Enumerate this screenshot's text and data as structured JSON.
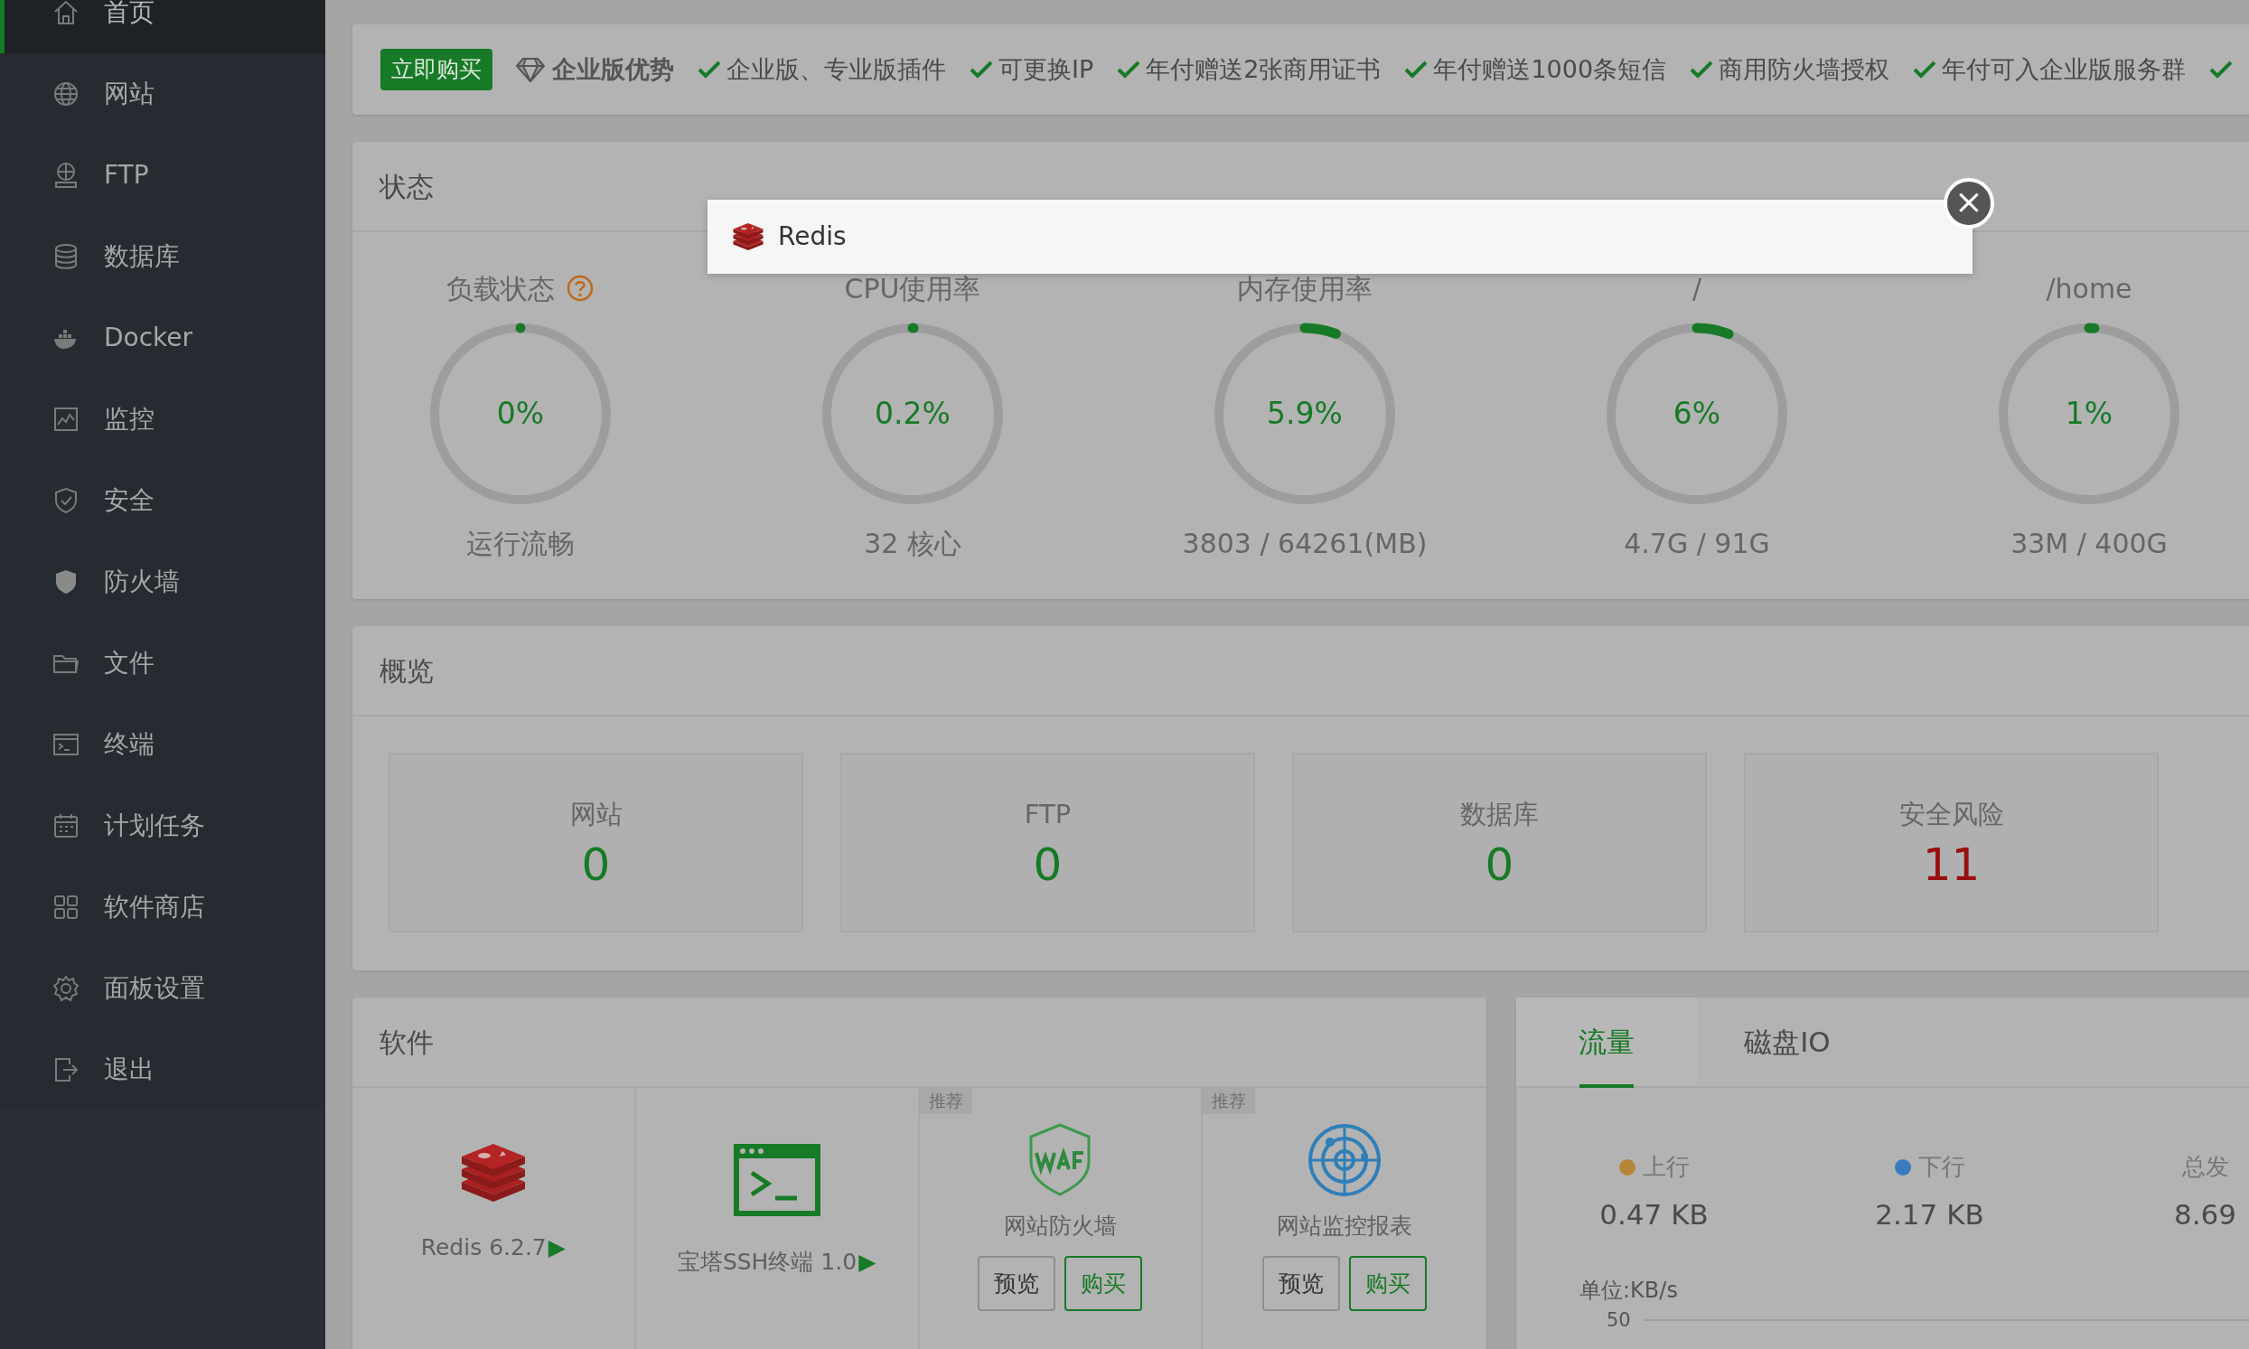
{
  "sidebar": {
    "items": [
      {
        "label": "首页",
        "selected": true
      },
      {
        "label": "网站",
        "selected": false
      },
      {
        "label": "FTP",
        "selected": false
      },
      {
        "label": "数据库",
        "selected": false
      },
      {
        "label": "Docker",
        "selected": false
      },
      {
        "label": "监控",
        "selected": false
      },
      {
        "label": "安全",
        "selected": false
      },
      {
        "label": "防火墙",
        "selected": false
      },
      {
        "label": "文件",
        "selected": false
      },
      {
        "label": "终端",
        "selected": false
      },
      {
        "label": "计划任务",
        "selected": false
      },
      {
        "label": "软件商店",
        "selected": false
      },
      {
        "label": "面板设置",
        "selected": false
      },
      {
        "label": "退出",
        "selected": false
      }
    ]
  },
  "banner": {
    "buy_button": "立即购买",
    "title": "企业版优势",
    "features": [
      "企业版、专业版插件",
      "可更换IP",
      "年付赠送2张商用证书",
      "年付赠送1000条短信",
      "商用防火墙授权",
      "年付可入企业版服务群"
    ],
    "trailing_check": true
  },
  "status": {
    "title": "状态",
    "gauges": [
      {
        "label": "负载状态",
        "help": true,
        "value": "0%",
        "level": 0,
        "detail": "运行流畅"
      },
      {
        "label": "CPU使用率",
        "help": false,
        "value": "0.2%",
        "level": 0.002,
        "detail": "32 核心"
      },
      {
        "label": "内存使用率",
        "help": false,
        "value": "5.9%",
        "level": 0.059,
        "detail": "3803 / 64261(MB)"
      },
      {
        "label": "/",
        "help": false,
        "value": "6%",
        "level": 0.06,
        "detail": "4.7G / 91G"
      },
      {
        "label": "/home",
        "help": false,
        "value": "1%",
        "level": 0.01,
        "detail": "33M / 400G"
      }
    ]
  },
  "overview": {
    "title": "概览",
    "items": [
      {
        "label": "网站",
        "value": "0",
        "alert": false
      },
      {
        "label": "FTP",
        "value": "0",
        "alert": false
      },
      {
        "label": "数据库",
        "value": "0",
        "alert": false
      },
      {
        "label": "安全风险",
        "value": "11",
        "alert": true
      }
    ]
  },
  "software": {
    "title": "软件",
    "items": [
      {
        "kind": "installed",
        "name": "Redis 6.2.7",
        "arrow": "▶"
      },
      {
        "kind": "installed",
        "name": "宝塔SSH终端 1.0",
        "arrow": "▶"
      },
      {
        "kind": "recommended",
        "tag": "推荐",
        "name": "网站防火墙",
        "buttons": [
          "预览",
          "购买"
        ]
      },
      {
        "kind": "recommended",
        "tag": "推荐",
        "name": "网站监控报表",
        "buttons": [
          "预览",
          "购买"
        ]
      }
    ]
  },
  "traffic": {
    "tabs": [
      {
        "label": "流量",
        "selected": true
      },
      {
        "label": "磁盘IO",
        "selected": false
      }
    ],
    "stats": [
      {
        "label": "上行",
        "value": "0.47 KB",
        "color": "#b5853a"
      },
      {
        "label": "下行",
        "value": "2.17 KB",
        "color": "#3b7bbd"
      },
      {
        "label": "总发",
        "value": "8.69"
      }
    ],
    "unit": "单位:KB/s",
    "y_tick": "50"
  },
  "modal": {
    "title": "Redis",
    "close": "×"
  }
}
